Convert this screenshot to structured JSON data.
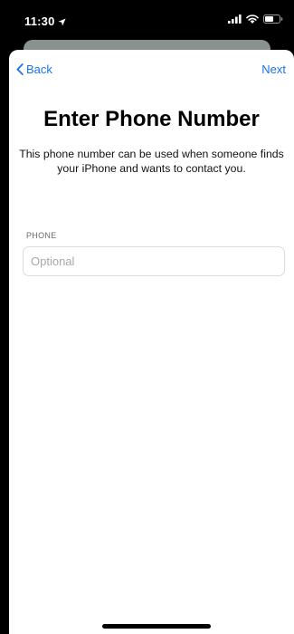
{
  "status_bar": {
    "time": "11:30",
    "icons": [
      "location-arrow-icon",
      "signal-icon",
      "wifi-icon",
      "battery-icon"
    ]
  },
  "nav": {
    "back_label": "Back",
    "next_label": "Next"
  },
  "main": {
    "title": "Enter Phone Number",
    "subtitle": "This phone number can be used when someone finds your iPhone and wants to contact you."
  },
  "phone_field": {
    "label": "PHONE",
    "placeholder": "Optional",
    "value": ""
  },
  "colors": {
    "accent": "#1a73e8",
    "background": "#ffffff",
    "chrome": "#000000"
  }
}
